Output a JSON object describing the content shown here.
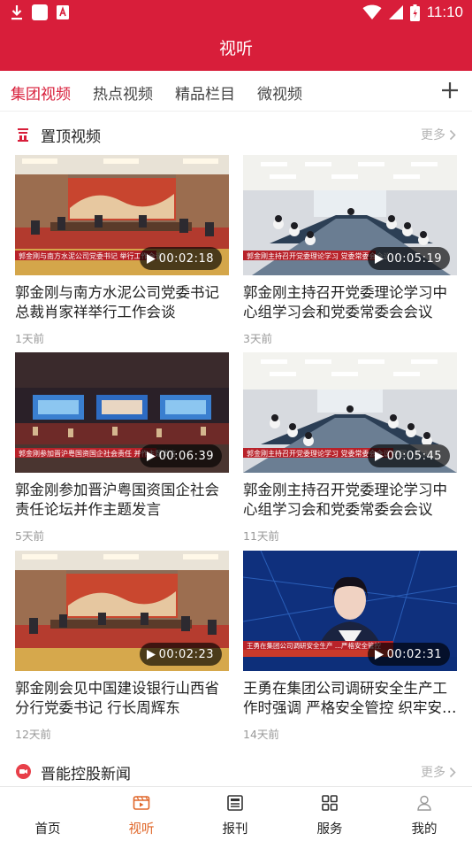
{
  "status": {
    "time": "11:10"
  },
  "header": {
    "title": "视听"
  },
  "tabs": [
    {
      "label": "集团视频",
      "active": true
    },
    {
      "label": "热点视频",
      "active": false
    },
    {
      "label": "精品栏目",
      "active": false
    },
    {
      "label": "微视频",
      "active": false
    }
  ],
  "pinned": {
    "title": "置顶视频",
    "more": "更多"
  },
  "videos": [
    {
      "title": "郭金刚与南方水泥公司党委书记  总裁肖家祥举行工作会谈",
      "duration": "00:02:18",
      "ago": "1天前",
      "caption": "郭金刚与南方水泥公司党委书记 举行工作会谈"
    },
    {
      "title": "郭金刚主持召开党委理论学习中心组学习会和党委常委会会议",
      "duration": "00:05:19",
      "ago": "3天前",
      "caption": "郭金刚主持召开党委理论学习 党委常委会会议"
    },
    {
      "title": "郭金刚参加晋沪粤国资国企社会责任论坛并作主题发言",
      "duration": "00:06:39",
      "ago": "5天前",
      "caption": "郭金刚参加晋沪粤国资国企社会责任 并作主题发言"
    },
    {
      "title": "郭金刚主持召开党委理论学习中心组学习会和党委常委会会议",
      "duration": "00:05:45",
      "ago": "11天前",
      "caption": "郭金刚主持召开党委理论学习 党委常委会会议 李国...参加"
    },
    {
      "title": "郭金刚会见中国建设银行山西省分行党委书记  行长周辉东",
      "duration": "00:02:23",
      "ago": "12天前",
      "caption": ""
    },
    {
      "title": "王勇在集团公司调研安全生产工作时强调  严格安全管控  织牢安全防线",
      "duration": "00:02:31",
      "ago": "14天前",
      "caption": "王勇在集团公司调研安全生产 ...严格安全管控"
    }
  ],
  "news": {
    "title": "晋能控股新闻",
    "more": "更多"
  },
  "bottom_nav": [
    {
      "label": "首页",
      "icon": "home-icon",
      "active": false
    },
    {
      "label": "视听",
      "icon": "video-icon",
      "active": true
    },
    {
      "label": "报刊",
      "icon": "newspaper-icon",
      "active": false
    },
    {
      "label": "服务",
      "icon": "grid-icon",
      "active": false
    },
    {
      "label": "我的",
      "icon": "person-icon",
      "active": false
    }
  ],
  "colors": {
    "brand": "#d81e3a",
    "nav_active": "#e0672a",
    "muted": "#999999"
  }
}
